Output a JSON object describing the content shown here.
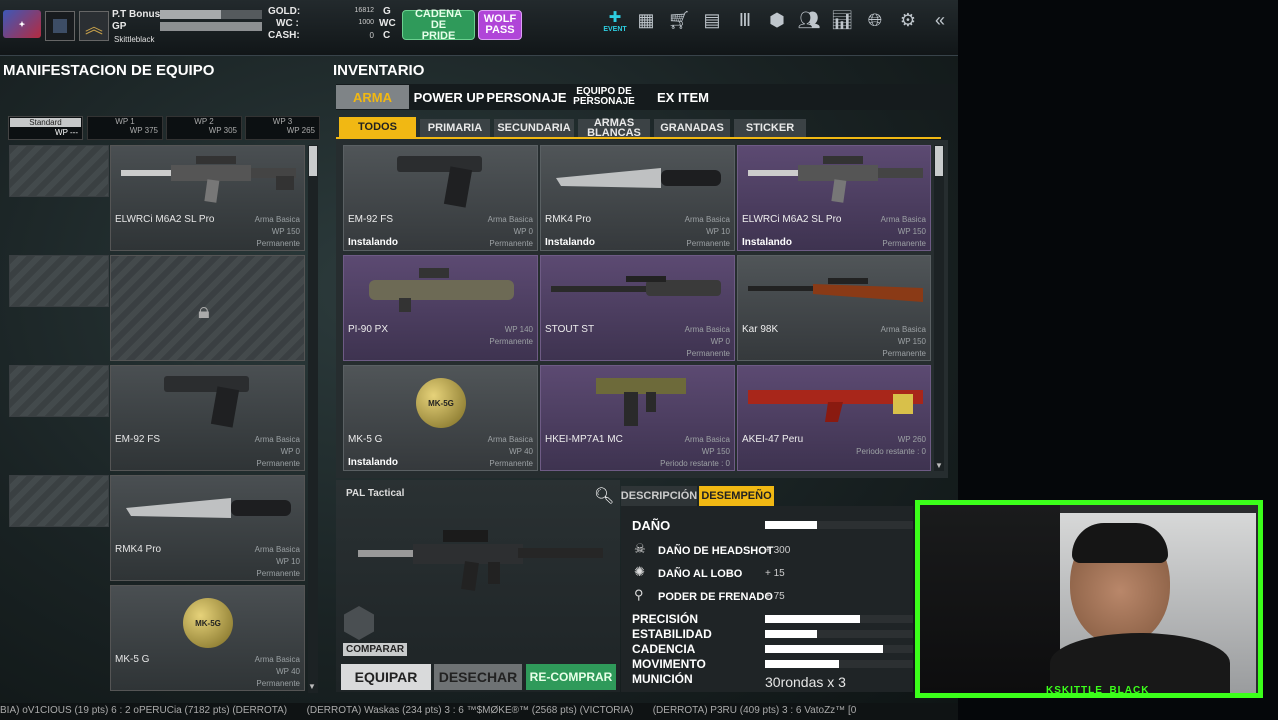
{
  "topbar": {
    "player_name": "P.T Bonus",
    "gp_label": "GP",
    "clan_name": "Skittleblack",
    "gold_label": "GOLD:",
    "wc_label": "WC :",
    "cash_label": "CASH:",
    "gold_value": "16812",
    "gold_unit": "G",
    "wc_value": "1000",
    "wc_unit": "WC",
    "cash_value": "0",
    "cash_unit": "C",
    "cadena_label": "CADENA DE PRIDE",
    "wolf_label": "WOLF PASS",
    "event_label": "EVENT"
  },
  "equipment": {
    "title": "MANIFESTACION DE EQUIPO",
    "tabs": [
      {
        "name": "Standard",
        "wp": "WP ---"
      },
      {
        "name": "WP 1",
        "wp": "WP 375"
      },
      {
        "name": "WP 2",
        "wp": "WP 305"
      },
      {
        "name": "WP 3",
        "wp": "WP 265"
      }
    ],
    "slots": [
      {
        "name": "ELWRCi M6A2 SL Pro",
        "type": "Arma Basica",
        "wp": "WP 150",
        "dur": "Permanente"
      },
      {
        "name": "",
        "type": "",
        "wp": "",
        "dur": ""
      },
      {
        "name": "EM-92 FS",
        "type": "Arma Basica",
        "wp": "WP 0",
        "dur": "Permanente"
      },
      {
        "name": "RMK4 Pro",
        "type": "Arma Basica",
        "wp": "WP 10",
        "dur": "Permanente"
      },
      {
        "name": "MK-5 G",
        "type": "Arma Basica",
        "wp": "WP 40",
        "dur": "Permanente"
      }
    ]
  },
  "inventory": {
    "title": "INVENTARIO",
    "tabs": [
      "ARMA",
      "POWER UP",
      "PERSONAJE",
      "EQUIPO DE PERSONAJE",
      "EX ITEM"
    ],
    "subtabs": [
      "TODOS",
      "PRIMARIA",
      "SECUNDARIA",
      "ARMAS BLANCAS",
      "GRANADAS",
      "STICKER"
    ],
    "items": [
      {
        "name": "EM-92 FS",
        "type": "Arma Basica",
        "wp": "WP 0",
        "dur": "Permanente",
        "status": "Instalando",
        "purple": false
      },
      {
        "name": "RMK4 Pro",
        "type": "Arma Basica",
        "wp": "WP 10",
        "dur": "Permanente",
        "status": "Instalando",
        "purple": false
      },
      {
        "name": "ELWRCi M6A2 SL Pro",
        "type": "Arma Basica",
        "wp": "WP 150",
        "dur": "Permanente",
        "status": "Instalando",
        "purple": true
      },
      {
        "name": "PI-90 PX",
        "type": "",
        "wp": "WP 140",
        "dur": "Permanente",
        "status": "",
        "purple": true
      },
      {
        "name": "STOUT ST",
        "type": "Arma Basica",
        "wp": "WP 0",
        "dur": "Permanente",
        "status": "",
        "purple": true
      },
      {
        "name": "Kar 98K",
        "type": "Arma Basica",
        "wp": "WP 150",
        "dur": "Permanente",
        "status": "",
        "purple": false
      },
      {
        "name": "MK-5 G",
        "type": "Arma Basica",
        "wp": "WP 40",
        "dur": "Permanente",
        "status": "Instalando",
        "purple": false
      },
      {
        "name": "HKEI-MP7A1 MC",
        "type": "Arma Basica",
        "wp": "WP 150",
        "dur": "Periodo restante : 0",
        "status": "",
        "purple": true
      },
      {
        "name": "AKEI-47 Peru",
        "type": "",
        "wp": "WP 260",
        "dur": "Periodo restante : 0",
        "status": "",
        "purple": true
      }
    ]
  },
  "detail": {
    "weapon_name": "PAL Tactical",
    "compare_label": "COMPARAR",
    "tab_desc": "DESCRIPCIÓN",
    "tab_perf": "DESEMPEÑO",
    "dano_label": "DAÑO",
    "dano_value": 0.35,
    "bonuses": [
      {
        "label": "DAÑO DE HEADSHOT",
        "value": "+ 300"
      },
      {
        "label": "DAÑO AL LOBO",
        "value": "+ 15"
      },
      {
        "label": "PODER DE FRENADO",
        "value": "+ 75"
      }
    ],
    "stats": [
      {
        "label": "PRECISIÓN",
        "value": 0.64
      },
      {
        "label": "ESTABILIDAD",
        "value": 0.35
      },
      {
        "label": "CADENCIA",
        "value": 0.8
      },
      {
        "label": "MOVIMENTO",
        "value": 0.5
      }
    ],
    "municion_label": "MUNICIÓN",
    "municion_value": "30rondas x 3",
    "buttons": {
      "equip": "EQUIPAR",
      "discard": "DESECHAR",
      "rebuy": "RE-COMPRAR"
    }
  },
  "ticker": "BIA) oV1CIOUS (19 pts) 6 : 2 oPERUCia (7182 pts) (DERROTA)       (DERROTA) Waskas (234 pts) 3 : 6 ™$MØKE®™ (2568 pts) (VICTORIA)       (DERROTA) P3RU (409 pts) 3 : 6 VatoZz™ [0",
  "webcam": {
    "name": "KSKITTLE_BLACK"
  },
  "colors": {
    "accent_yellow": "#f1b813",
    "green_button": "#2f9a5a",
    "purple_button": "#b045d8",
    "webcam_frame": "#3bff1a"
  }
}
